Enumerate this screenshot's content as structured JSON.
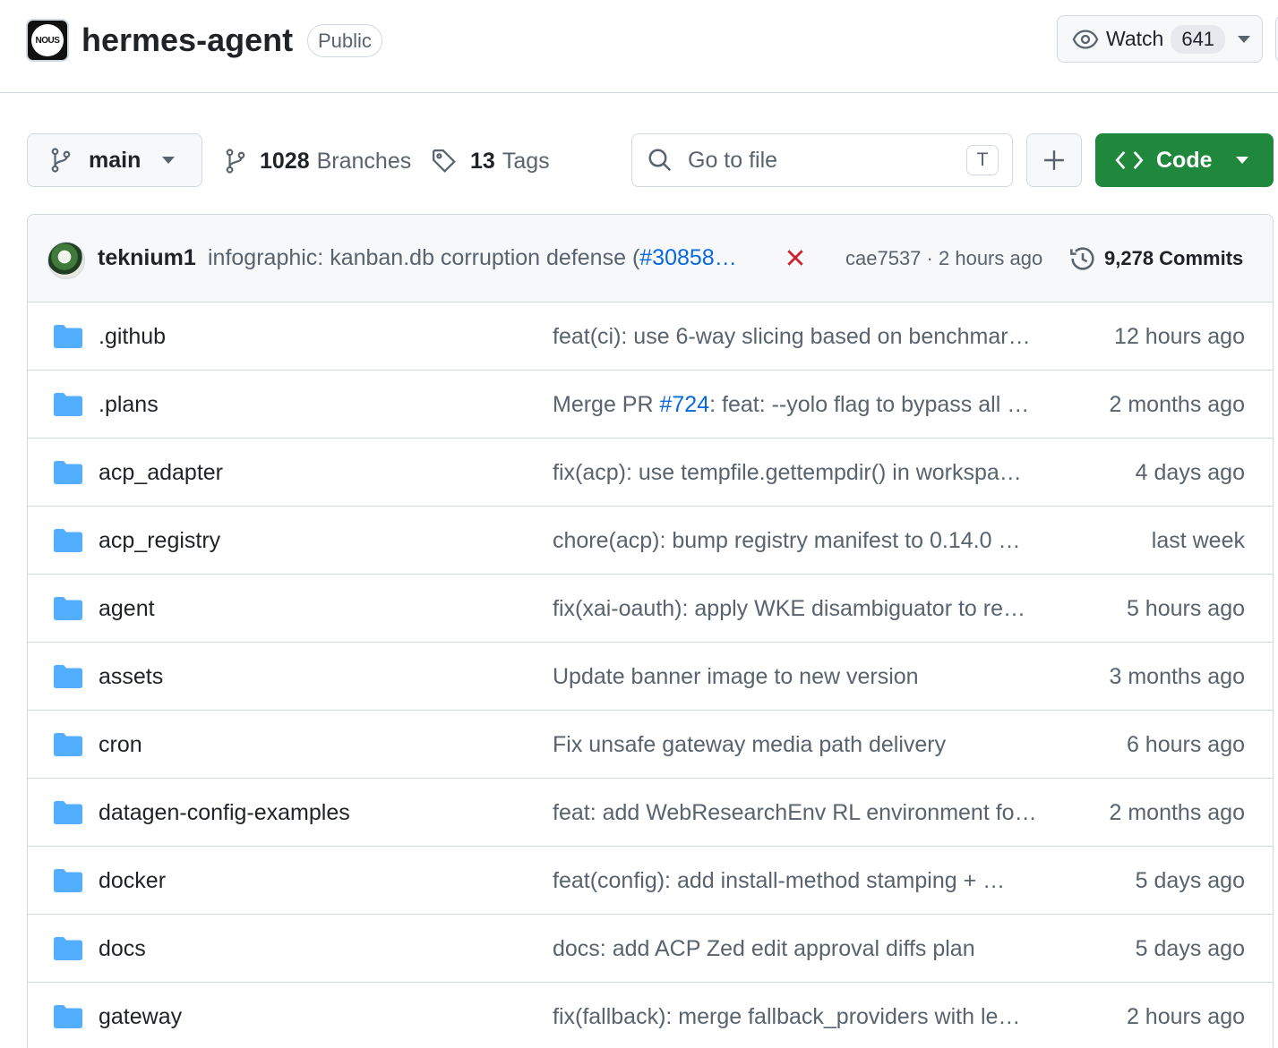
{
  "header": {
    "org_logo_text": "NOUS",
    "repo_name": "hermes-agent",
    "visibility": "Public",
    "watch_label": "Watch",
    "watch_count": "641"
  },
  "toolbar": {
    "branch": "main",
    "branches_count": "1028",
    "branches_label": "Branches",
    "tags_count": "13",
    "tags_label": "Tags",
    "search_placeholder": "Go to file",
    "search_shortcut": "T",
    "code_label": "Code",
    "code_color": "#1f883d"
  },
  "latest_commit": {
    "author": "teknium1",
    "message_prefix": "infographic: kanban.db corruption defense (",
    "message_link": "#30858…",
    "status": "failed",
    "status_color": "#cf222e",
    "sha": "cae7537",
    "separator": "·",
    "time": "2 hours ago",
    "commits_count_label": "9,278 Commits"
  },
  "files": [
    {
      "name": ".github",
      "msg_pre": "feat(ci): use 6-way slicing based on benchmar…",
      "msg_link": "",
      "msg_post": "",
      "time": "12 hours ago"
    },
    {
      "name": ".plans",
      "msg_pre": "Merge PR ",
      "msg_link": "#724",
      "msg_post": ": feat: --yolo flag to bypass all …",
      "time": "2 months ago"
    },
    {
      "name": "acp_adapter",
      "msg_pre": "fix(acp): use tempfile.gettempdir() in workspa…",
      "msg_link": "",
      "msg_post": "",
      "time": "4 days ago"
    },
    {
      "name": "acp_registry",
      "msg_pre": "chore(acp): bump registry manifest to 0.14.0 …",
      "msg_link": "",
      "msg_post": "",
      "time": "last week"
    },
    {
      "name": "agent",
      "msg_pre": "fix(xai-oauth): apply WKE disambiguator to re…",
      "msg_link": "",
      "msg_post": "",
      "time": "5 hours ago"
    },
    {
      "name": "assets",
      "msg_pre": "Update banner image to new version",
      "msg_link": "",
      "msg_post": "",
      "time": "3 months ago"
    },
    {
      "name": "cron",
      "msg_pre": "Fix unsafe gateway media path delivery",
      "msg_link": "",
      "msg_post": "",
      "time": "6 hours ago"
    },
    {
      "name": "datagen-config-examples",
      "msg_pre": "feat: add WebResearchEnv RL environment fo…",
      "msg_link": "",
      "msg_post": "",
      "time": "2 months ago"
    },
    {
      "name": "docker",
      "msg_pre": "feat(config): add install-method stamping + …",
      "msg_link": "",
      "msg_post": "",
      "time": "5 days ago"
    },
    {
      "name": "docs",
      "msg_pre": "docs: add ACP Zed edit approval diffs plan",
      "msg_link": "",
      "msg_post": "",
      "time": "5 days ago"
    },
    {
      "name": "gateway",
      "msg_pre": "fix(fallback): merge fallback_providers with le…",
      "msg_link": "",
      "msg_post": "",
      "time": "2 hours ago"
    }
  ],
  "icons": {
    "folder_color": "#54aeff",
    "link_color": "#0969da"
  }
}
